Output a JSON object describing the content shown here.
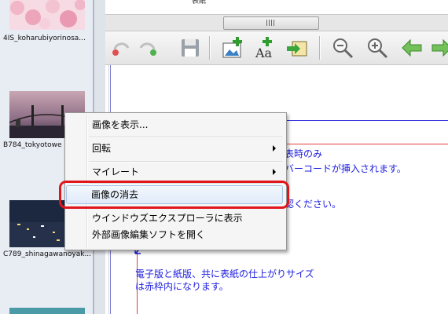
{
  "thumbnails": [
    {
      "label": "4IS_koharubiyorinosa..."
    },
    {
      "label": "B784_tokyotowe"
    },
    {
      "label": "C789_shinagawanoyak..."
    }
  ],
  "top_area": {
    "text": "表紙"
  },
  "toolbar": {
    "buttons": [
      {
        "icon": "undo-icon"
      },
      {
        "icon": "redo-icon"
      },
      {
        "icon": "save-icon"
      },
      {
        "icon": "add-image-icon"
      },
      {
        "icon": "add-text-icon"
      },
      {
        "icon": "import-icon"
      },
      {
        "icon": "zoom-out-icon"
      },
      {
        "icon": "zoom-in-icon"
      },
      {
        "icon": "arrow-left-icon"
      },
      {
        "icon": "arrow-right-icon"
      }
    ]
  },
  "document": {
    "lines": [
      "表時のみ",
      "バーコードが挿入されます。",
      "認ください。",
      "電子版と紙版、共に表紙の仕上がりサイズ",
      "は赤枠内になります。"
    ]
  },
  "context_menu": {
    "items": [
      {
        "label": "画像を表示..."
      },
      {
        "label": "回転"
      },
      {
        "label": "マイレート"
      },
      {
        "label": "画像の消去"
      },
      {
        "label": "ウインドウズエクスプローラに表示"
      },
      {
        "label": "外部画像編集ソフトを開く"
      }
    ]
  },
  "colors": {
    "highlight_annotation": "#e0161b",
    "doc_text": "#1d1de0"
  }
}
